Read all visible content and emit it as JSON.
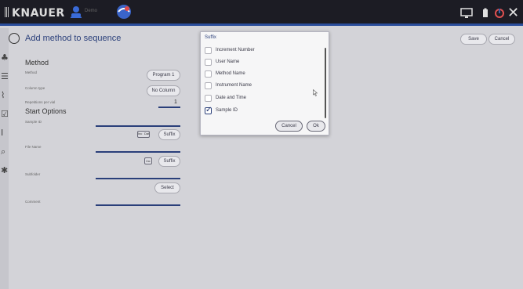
{
  "header_bar": {
    "brand": "KNAUER",
    "user": "Demo"
  },
  "page": {
    "title": "Add method to sequence",
    "save_label": "Save",
    "cancel_label": "Cancel"
  },
  "method_section": {
    "title": "Method",
    "method_label": "Method",
    "method_value": "Program 1",
    "column_type_label": "Column type",
    "column_type_value": "No Column",
    "repetitions_label": "Repetitions per vial",
    "repetitions_value": "1"
  },
  "start_options": {
    "title": "Start Options",
    "sample_id_label": "Sample ID",
    "sample_id_buttons": [
      "Inc",
      "Dat"
    ],
    "suffix_label": "Suffix",
    "file_name_label": "File Name",
    "file_name_button": "Inc",
    "file_suffix_label": "Suffix",
    "subfolder_label": "Subfolder",
    "select_label": "Select",
    "comment_label": "Comment"
  },
  "dialog": {
    "title": "Suffix",
    "options": [
      {
        "label": "Increment Number",
        "checked": false
      },
      {
        "label": "User Name",
        "checked": false
      },
      {
        "label": "Method Name",
        "checked": false
      },
      {
        "label": "Instrument Name",
        "checked": false
      },
      {
        "label": "Date and Time",
        "checked": false
      },
      {
        "label": "Sample ID",
        "checked": true
      }
    ],
    "cancel_label": "Cancel",
    "ok_label": "Ok"
  },
  "colors": {
    "top_bar": "#1c1c24",
    "accent": "#2a4d9b",
    "title_text": "#2a3f7a",
    "background": "#d3d3d8"
  }
}
